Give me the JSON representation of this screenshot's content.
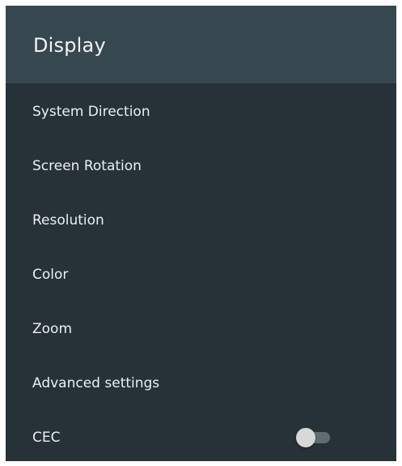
{
  "header": {
    "title": "Display"
  },
  "menu": {
    "items": [
      {
        "label": "System Direction"
      },
      {
        "label": "Screen Rotation"
      },
      {
        "label": "Resolution"
      },
      {
        "label": "Color"
      },
      {
        "label": "Zoom"
      },
      {
        "label": "Advanced settings"
      },
      {
        "label": "CEC",
        "toggle": {
          "state": "off"
        }
      }
    ]
  },
  "colors": {
    "panel_background": "#263238",
    "header_background": "#37474f",
    "text": "#eceff1",
    "toggle_track_off": "#5f6d73",
    "toggle_thumb_off": "#d8d8d8"
  }
}
